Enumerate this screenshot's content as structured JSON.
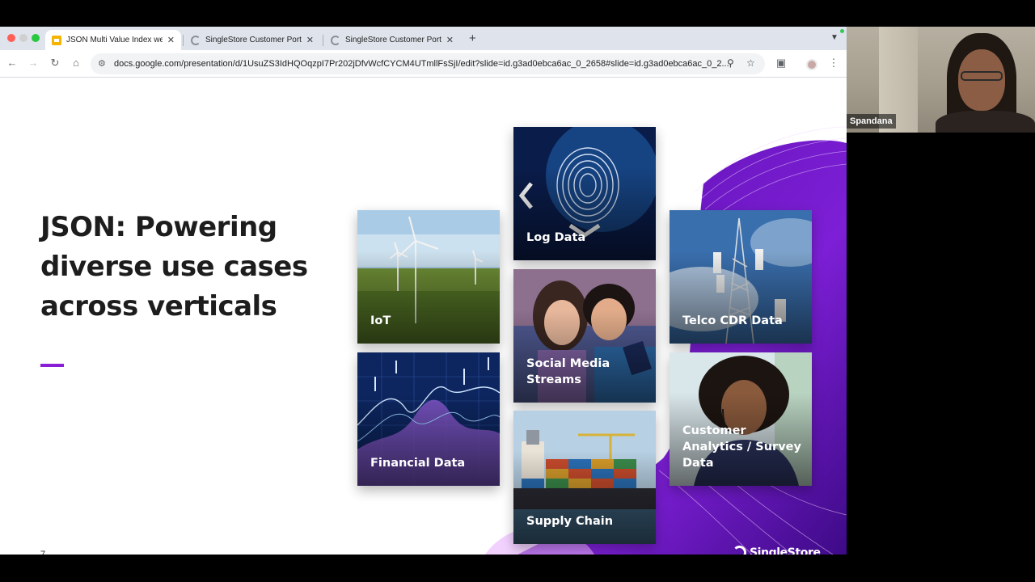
{
  "browser": {
    "tabs": [
      {
        "title": "JSON Multi Value Index webi",
        "active": true,
        "favicon": "slides-icon"
      },
      {
        "title": "SingleStore Customer Portal",
        "active": false,
        "favicon": "loading-icon"
      },
      {
        "title": "SingleStore Customer Portal",
        "active": false,
        "favicon": "loading-icon"
      }
    ],
    "tab_close_glyph": "✕",
    "new_tab_glyph": "+",
    "url": "docs.google.com/presentation/d/1UsuZS3IdHQOqzpI7Pr202jDfvWcfCYCM4UTmllFsSjI/edit?slide=id.g3ad0ebca6ac_0_2658#slide=id.g3ad0ebca6ac_0_2..."
  },
  "slide": {
    "title_lines": [
      "JSON: Powering",
      "diverse use cases",
      "across verticals"
    ],
    "page_number": "7",
    "accent_color": "#8a1ed6",
    "tiles": [
      {
        "label": "IoT",
        "icon": "wind-turbine-image"
      },
      {
        "label": "Log Data",
        "icon": "fingerprint-image"
      },
      {
        "label": "Social Media Streams",
        "icon": "people-phone-image"
      },
      {
        "label": "Financial Data",
        "icon": "stock-chart-image"
      },
      {
        "label": "Supply Chain",
        "icon": "cargo-ship-image"
      },
      {
        "label": "Telco CDR Data",
        "icon": "cell-tower-image"
      },
      {
        "label": "Customer Analytics / Survey Data",
        "icon": "call-agent-image"
      }
    ],
    "brand": "SingleStore"
  },
  "video": {
    "participant_name": "Spandana"
  }
}
